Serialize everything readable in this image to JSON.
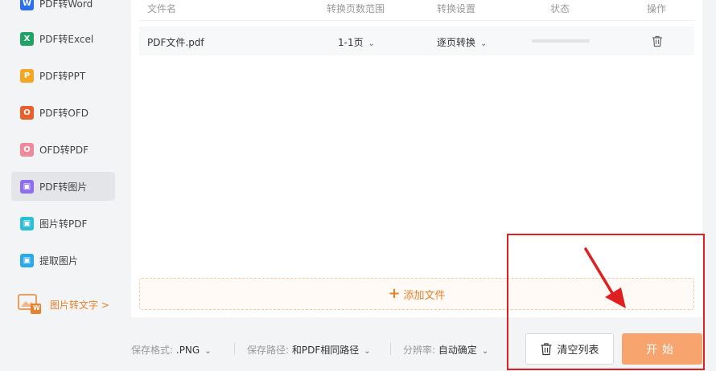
{
  "sidebar": {
    "items": [
      {
        "label": "PDF转Word",
        "icon": "W",
        "icon_name": "word-icon",
        "color": "#2b6ef2",
        "active": false
      },
      {
        "label": "PDF转Excel",
        "icon": "X",
        "icon_name": "excel-icon",
        "color": "#21a366",
        "active": false
      },
      {
        "label": "PDF转PPT",
        "icon": "P",
        "icon_name": "ppt-icon",
        "color": "#f5a623",
        "active": false
      },
      {
        "label": "PDF转OFD",
        "icon": "O",
        "icon_name": "ofd-icon",
        "color": "#e8612c",
        "active": false
      },
      {
        "label": "OFD转PDF",
        "icon": "O",
        "icon_name": "pdf-icon",
        "color": "#f08a9a",
        "active": false
      },
      {
        "label": "PDF转图片",
        "icon": "▣",
        "icon_name": "pdf-to-image-icon",
        "color": "#8f6cf0",
        "active": true
      },
      {
        "label": "图片转PDF",
        "icon": "▣",
        "icon_name": "image-to-pdf-icon",
        "color": "#2bbfd6",
        "active": false
      },
      {
        "label": "提取图片",
        "icon": "▣",
        "icon_name": "extract-image-icon",
        "color": "#2aa8e8",
        "active": false
      }
    ],
    "promo": {
      "label": "图片转文字 >",
      "badge": "W"
    }
  },
  "table": {
    "headers": {
      "name": "文件名",
      "range": "转换页数范围",
      "settings": "转换设置",
      "status": "状态",
      "action": "操作"
    },
    "rows": [
      {
        "name": "PDF文件.pdf",
        "range": "1-1页",
        "settings": "逐页转换",
        "progress": 0
      }
    ]
  },
  "add_file": {
    "label": "添加文件"
  },
  "options": {
    "format_label": "保存格式:",
    "format_value": ".PNG",
    "path_label": "保存路径:",
    "path_value": "和PDF相同路径",
    "resolution_label": "分辨率:",
    "resolution_value": "自动确定"
  },
  "buttons": {
    "clear": "清空列表",
    "start": "开始"
  },
  "colors": {
    "accent": "#e8812a",
    "start_button": "#f8a46f",
    "annotation": "#e02020"
  }
}
